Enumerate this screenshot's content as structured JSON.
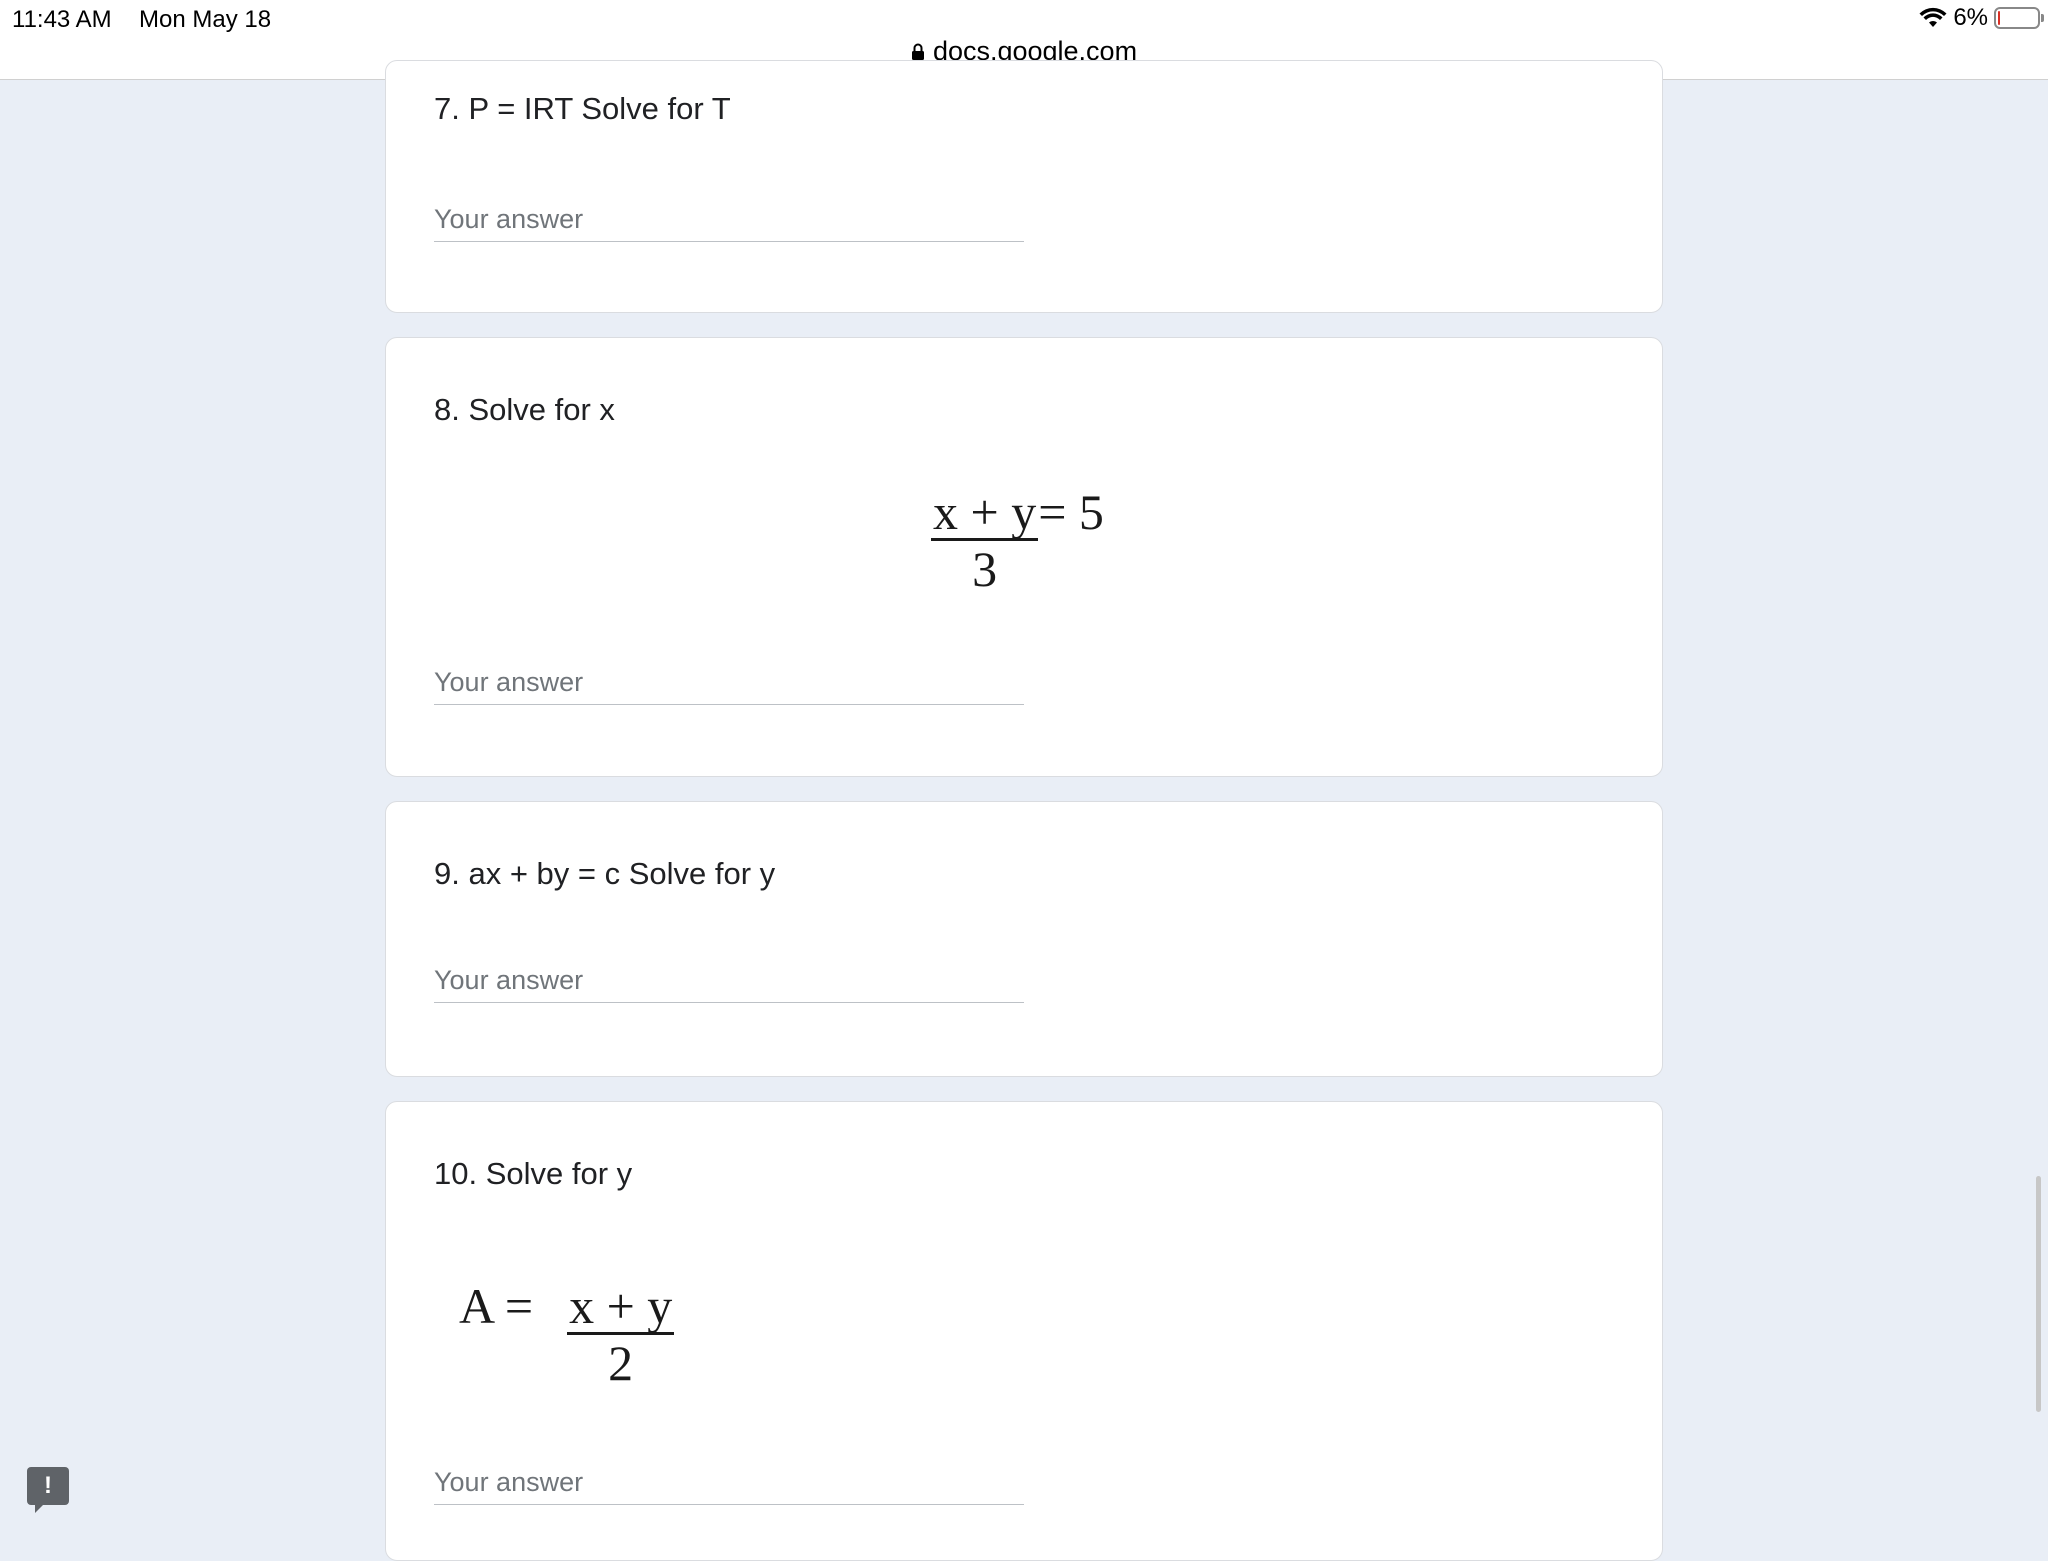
{
  "status_bar": {
    "time": "11:43 AM",
    "date": "Mon May 18",
    "battery_percent": "6%",
    "battery_level": 0.06
  },
  "browser": {
    "url": "docs.google.com"
  },
  "form": {
    "answer_placeholder": "Your answer",
    "questions": [
      {
        "title": "7. P = IRT Solve for T"
      },
      {
        "title": "8. Solve for x",
        "formula": {
          "numerator": "x + y",
          "denominator": "3",
          "rest": "= 5"
        }
      },
      {
        "title": "9. ax + by = c Solve for y"
      },
      {
        "title": "10. Solve for y",
        "formula": {
          "prefix": "A =",
          "numerator": "x + y",
          "denominator": "2"
        }
      }
    ]
  },
  "feedback_button": {
    "label": "!"
  },
  "icons": {
    "wifi": "wifi-icon",
    "battery": "battery-icon",
    "lock": "lock-icon",
    "feedback": "feedback-icon"
  },
  "colors": {
    "page_background": "#e9eef6",
    "card_background": "#ffffff",
    "battery_low": "#d93025"
  }
}
